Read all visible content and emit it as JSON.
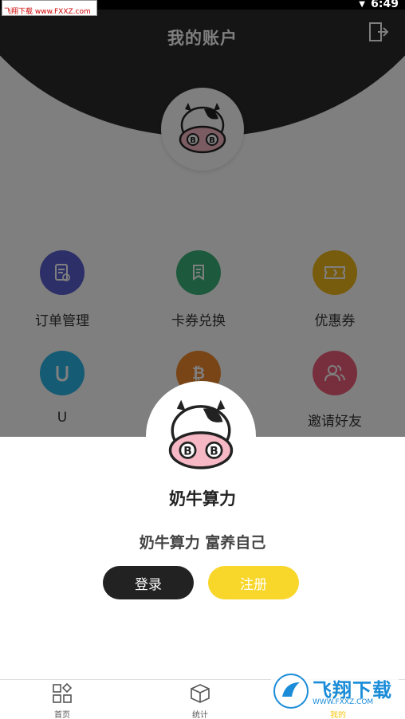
{
  "status_bar": {
    "time": "6:49",
    "watermark": "飞翔下载 www.FXXZ.com"
  },
  "header": {
    "title": "我的账户"
  },
  "menu": [
    {
      "label": "订单管理",
      "icon": "order-icon",
      "color": "#5b5fd1"
    },
    {
      "label": "卡券兑换",
      "icon": "card-exchange-icon",
      "color": "#3bb57b"
    },
    {
      "label": "优惠券",
      "icon": "coupon-icon",
      "color": "#f0b81a"
    },
    {
      "label": "U",
      "icon": "u-icon",
      "color": "#2bb6e8"
    },
    {
      "label": "",
      "icon": "bitcoin-icon",
      "color": "#f28a2c"
    },
    {
      "label": "邀请好友",
      "icon": "invite-friends-icon",
      "color": "#ef5f7a"
    }
  ],
  "sheet": {
    "app_name": "奶牛算力",
    "slogan": "奶牛算力 富养自己",
    "login_label": "登录",
    "register_label": "注册"
  },
  "tabs": [
    {
      "label": "首页",
      "icon": "home-grid-icon"
    },
    {
      "label": "统计",
      "icon": "cube-icon"
    },
    {
      "label": "我的",
      "icon": "profile-icon"
    }
  ],
  "watermark": {
    "text": "飞翔下载",
    "url": "WWW.FXXZ.COM"
  },
  "colors": {
    "accent": "#f8d62a",
    "dark": "#222222"
  }
}
